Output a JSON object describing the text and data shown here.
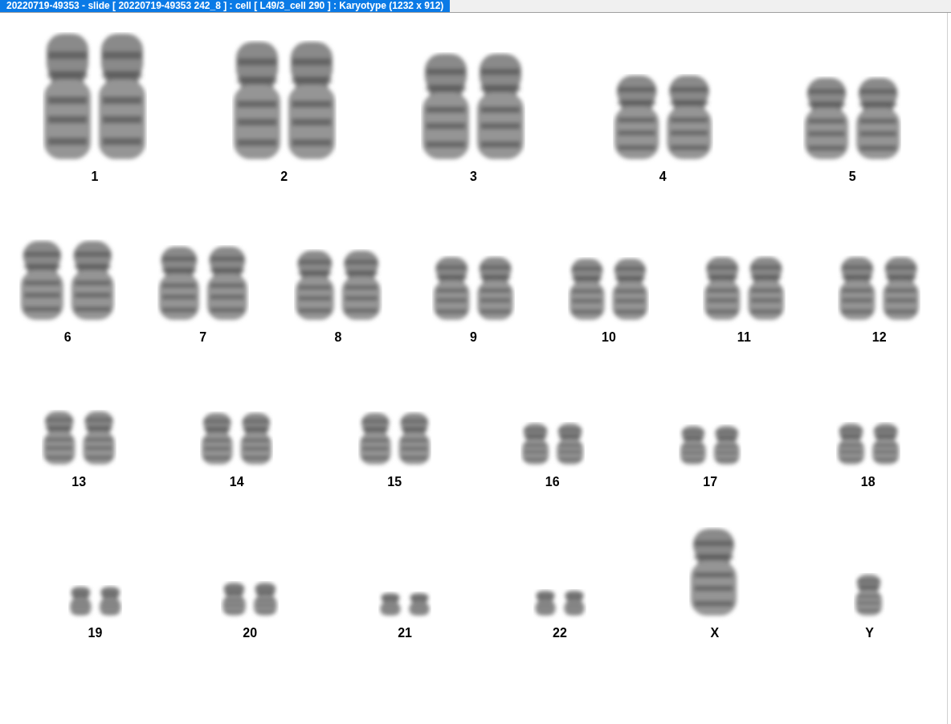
{
  "window": {
    "title": "20220719-49353 - slide [ 20220719-49353 242_8 ] : cell [ L49/3_cell 290 ] : Karyotype  (1232 x 912)"
  },
  "karyotype": {
    "rows": [
      [
        {
          "label": "1",
          "kind": "pair"
        },
        {
          "label": "2",
          "kind": "pair"
        },
        {
          "label": "3",
          "kind": "pair"
        },
        {
          "label": "4",
          "kind": "pair"
        },
        {
          "label": "5",
          "kind": "pair"
        }
      ],
      [
        {
          "label": "6",
          "kind": "pair"
        },
        {
          "label": "7",
          "kind": "pair"
        },
        {
          "label": "8",
          "kind": "pair"
        },
        {
          "label": "9",
          "kind": "pair"
        },
        {
          "label": "10",
          "kind": "pair"
        },
        {
          "label": "11",
          "kind": "pair"
        },
        {
          "label": "12",
          "kind": "pair"
        }
      ],
      [
        {
          "label": "13",
          "kind": "pair"
        },
        {
          "label": "14",
          "kind": "pair"
        },
        {
          "label": "15",
          "kind": "pair"
        },
        {
          "label": "16",
          "kind": "pair"
        },
        {
          "label": "17",
          "kind": "pair"
        },
        {
          "label": "18",
          "kind": "pair"
        }
      ],
      [
        {
          "label": "19",
          "kind": "pair"
        },
        {
          "label": "20",
          "kind": "pair"
        },
        {
          "label": "21",
          "kind": "pair"
        },
        {
          "label": "22",
          "kind": "pair"
        },
        {
          "label": "X",
          "kind": "single"
        },
        {
          "label": "Y",
          "kind": "single"
        }
      ]
    ]
  }
}
